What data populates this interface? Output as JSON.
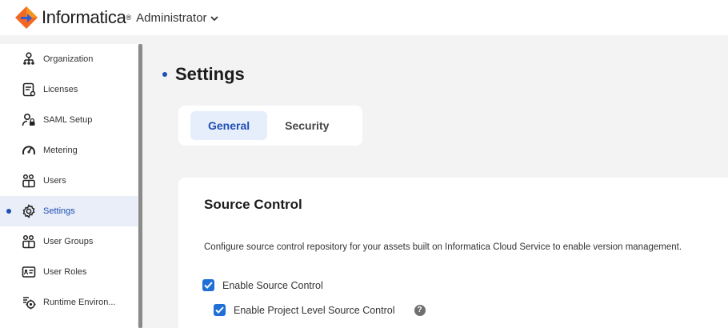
{
  "header": {
    "brand": "Informatica",
    "brand_mark": "®",
    "app_name": "Administrator"
  },
  "sidebar": {
    "items": [
      {
        "label": "Organization",
        "icon": "organization-icon"
      },
      {
        "label": "Licenses",
        "icon": "licenses-icon"
      },
      {
        "label": "SAML Setup",
        "icon": "saml-setup-icon"
      },
      {
        "label": "Metering",
        "icon": "metering-icon"
      },
      {
        "label": "Users",
        "icon": "users-icon"
      },
      {
        "label": "Settings",
        "icon": "gear-icon",
        "active": true
      },
      {
        "label": "User Groups",
        "icon": "user-groups-icon"
      },
      {
        "label": "User Roles",
        "icon": "user-roles-icon"
      },
      {
        "label": "Runtime Environ...",
        "icon": "runtime-environment-icon"
      }
    ]
  },
  "main": {
    "title": "Settings",
    "tabs": [
      {
        "label": "General",
        "active": true
      },
      {
        "label": "Security"
      }
    ],
    "section": {
      "title": "Source Control",
      "description": "Configure source control repository for your assets built on Informatica Cloud Service to enable version management.",
      "options": [
        {
          "label": "Enable Source Control",
          "checked": true
        },
        {
          "label": "Enable Project Level Source Control",
          "checked": true
        }
      ]
    }
  },
  "colors": {
    "accent": "#1f4fb3",
    "checkbox": "#1f6fd6",
    "logo_orange": "#f26722",
    "logo_blue": "#2d5bd6"
  }
}
